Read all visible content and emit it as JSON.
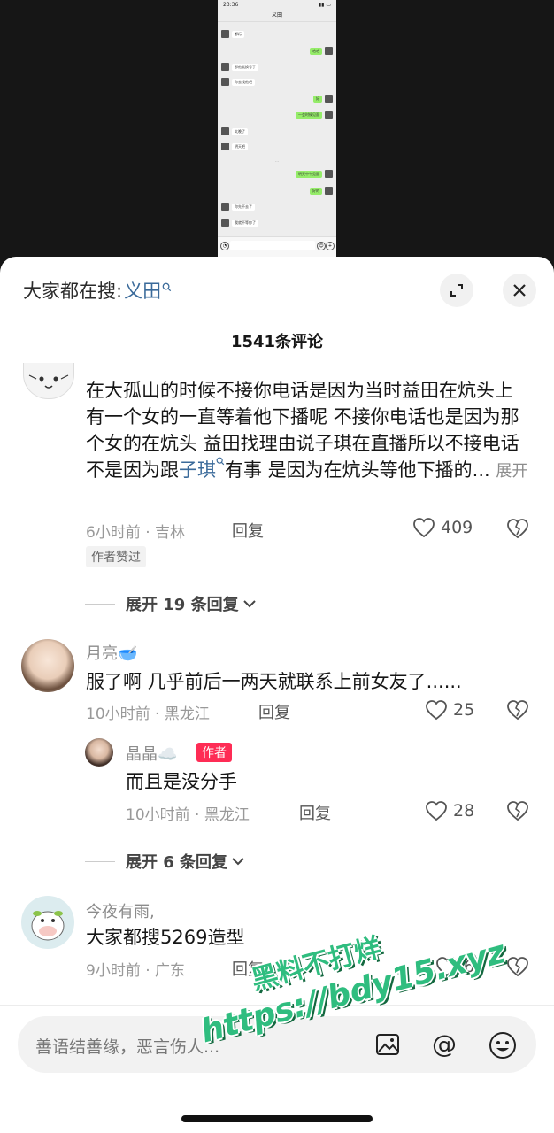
{
  "video": {
    "phone_time": "23:36",
    "phone_title": "义田",
    "phone_messages": [
      {
        "side": "l",
        "text": "都行"
      },
      {
        "side": "r",
        "text": "哈哈"
      },
      {
        "side": "l",
        "text": "那他就换号了"
      },
      {
        "side": "l",
        "text": "你去找他吧"
      },
      {
        "side": "r",
        "text": "好"
      },
      {
        "side": "r",
        "text": "一会时候见面"
      },
      {
        "side": "l",
        "text": "太晚了"
      },
      {
        "side": "l",
        "text": "明天吧"
      },
      {
        "side": "r",
        "text": "明天中午见面"
      },
      {
        "side": "r",
        "text": "好的"
      },
      {
        "side": "l",
        "text": "你先不去了"
      },
      {
        "side": "l",
        "text": "我就不等你了"
      }
    ]
  },
  "header": {
    "search_prefix": "大家都在搜:",
    "search_keyword": "义田",
    "expand_icon": "collapse-arrows-icon",
    "close_icon": "close-icon"
  },
  "comment_count": "1541条评论",
  "comments": [
    {
      "text_part1": "在大孤山的时候不接你电话是因为当时益田在炕头上有一个女的一直等着他下播呢 不接你电话也是因为那个女的在炕头 益田找理由说子琪在直播所以不接电话不是因为跟",
      "link": "子琪",
      "text_part2": "有事 是因为在炕头等他下播的...",
      "more": "展开",
      "meta": "6小时前 · 吉林",
      "reply": "回复",
      "likes": "409",
      "badge": "作者赞过",
      "expand": "展开 19 条回复"
    },
    {
      "user": "月亮🥣",
      "text": "服了啊 几乎前后一两天就联系上前女友了......",
      "meta": "10小时前 · 黑龙江",
      "reply": "回复",
      "likes": "25",
      "sub": {
        "user": "晶晶☁️",
        "badge": "作者",
        "text": "而且是没分手",
        "meta": "10小时前 · 黑龙江",
        "reply": "回复",
        "likes": "28"
      },
      "expand": "展开 6 条回复"
    },
    {
      "user": "今夜有雨,",
      "text": "大家都搜5269造型",
      "meta": "9小时前 · 广东",
      "reply": "回复",
      "likes": "6"
    }
  ],
  "input": {
    "placeholder": "善语结善缘，恶言伤人..."
  },
  "watermark": {
    "line1": "黑料不打烊",
    "line2": "https://bdy15.xyz"
  },
  "colors": {
    "link": "#3a6a9a",
    "author_badge": "#fe2c55",
    "watermark": "#2fbd7f"
  }
}
